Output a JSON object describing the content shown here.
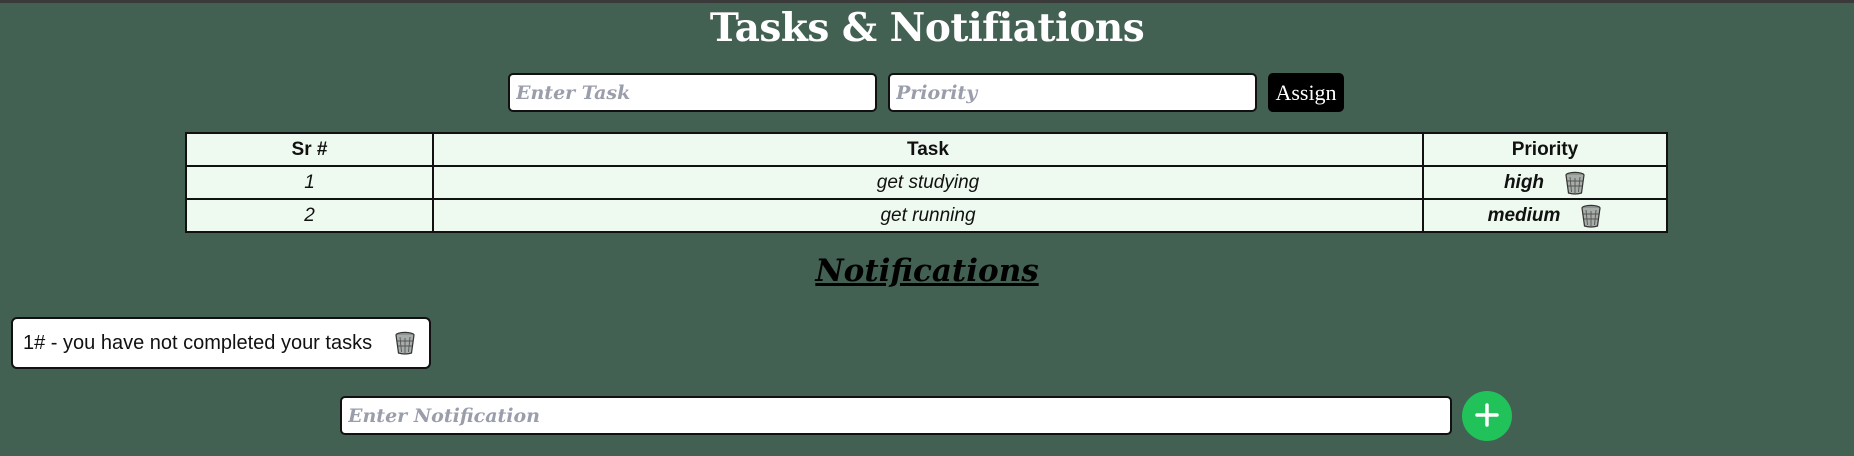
{
  "page": {
    "title": "Tasks & Notifiations"
  },
  "task_form": {
    "task_placeholder": "Enter Task",
    "priority_placeholder": "Priority",
    "assign_label": "Assign"
  },
  "tasks_table": {
    "headers": [
      "Sr #",
      "Task",
      "Priority"
    ],
    "rows": [
      {
        "sr": "1",
        "task": "get studying",
        "priority": "high"
      },
      {
        "sr": "2",
        "task": "get running",
        "priority": "medium"
      }
    ]
  },
  "notifications": {
    "heading": "Notifications",
    "items": [
      {
        "text": "1# - you have not completed your tasks"
      }
    ],
    "input_placeholder": "Enter Notification",
    "add_icon": "plus-icon"
  },
  "icons": {
    "delete": "trash-icon",
    "add": "plus-icon"
  },
  "colors": {
    "background": "#426153",
    "table_bg": "#eefaef",
    "add_button": "#22c25a",
    "assign_button": "#000000"
  }
}
